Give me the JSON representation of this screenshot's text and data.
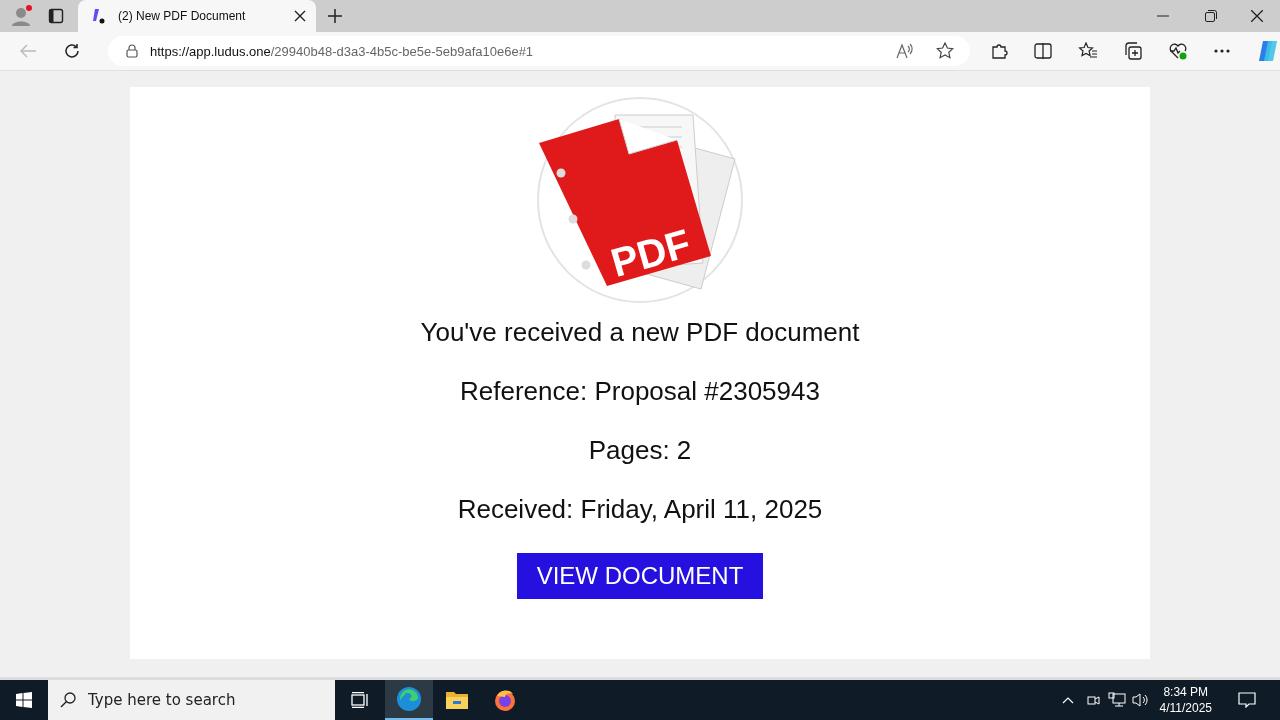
{
  "browser": {
    "tab": {
      "title": "(2) New PDF Document",
      "selected": true
    },
    "url": {
      "host": "https://app.ludus.one",
      "path": "/29940b48-d3a3-4b5c-be5e-5eb9afa10e6e#1"
    }
  },
  "page": {
    "logo_label": "PDF",
    "heading": "You've received a new PDF document",
    "details": [
      "Reference: Proposal #2305943",
      "Pages: 2",
      "Received: Friday, April 11, 2025"
    ],
    "button": "VIEW DOCUMENT"
  },
  "taskbar": {
    "search_placeholder": "Type here to search",
    "time": "8:34 PM",
    "date": "4/11/2025"
  }
}
